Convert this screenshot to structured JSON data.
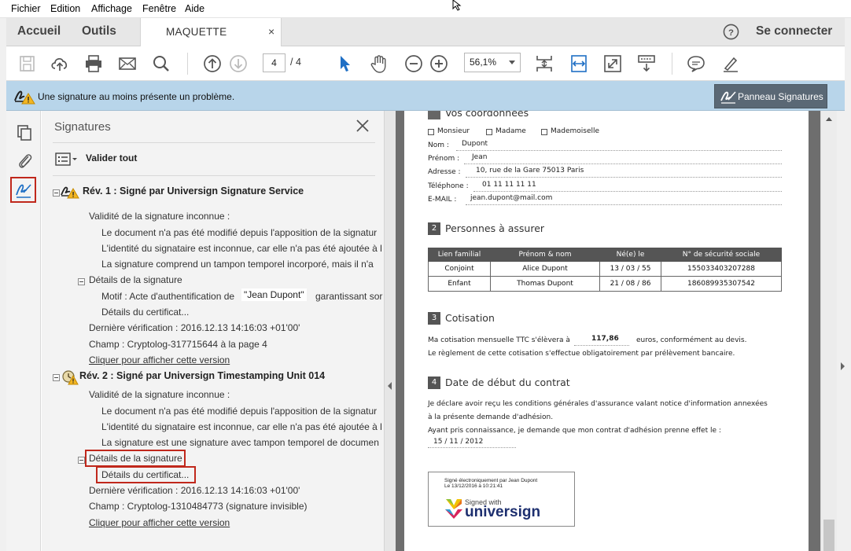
{
  "menu": {
    "items": [
      "Fichier",
      "Edition",
      "Affichage",
      "Fenêtre",
      "Aide"
    ]
  },
  "nav": {
    "home": "Accueil",
    "tools": "Outils",
    "doc_tab": "MAQUETTE",
    "close": "×",
    "signin": "Se connecter"
  },
  "toolbar": {
    "page_current": "4",
    "page_total": "/ 4",
    "zoom": "56,1%"
  },
  "banner": {
    "message": "Une signature au moins présente un problème.",
    "panel_button": "Panneau Signatures"
  },
  "signatures": {
    "title": "Signatures",
    "validate_all": "Valider tout",
    "rev1": {
      "header": "Rév. 1 : Signé par Universign Signature Service",
      "validity": "Validité de la signature inconnue :",
      "v1": "Le document n'a pas été modifié depuis l'apposition de la signatur",
      "v2": "L'identité du signataire est inconnue, car elle n'a pas été ajoutée à l",
      "v3": "La signature comprend un tampon temporel incorporé, mais il n'a",
      "details": "Détails de la signature",
      "motive_prefix": "Motif : Acte d'authentification de",
      "motive_name": "\"Jean Dupont\"",
      "motive_suffix": "garantissant sor",
      "cert": "Détails du certificat...",
      "last_check": "Dernière vérification : 2016.12.13 14:16:03 +01'00'",
      "field": "Champ : Cryptolog-317715644 à la page 4",
      "show": "Cliquer pour afficher cette version"
    },
    "rev2": {
      "header": "Rév. 2 : Signé par Universign Timestamping Unit 014",
      "validity": "Validité de la signature inconnue :",
      "v1": "Le document n'a pas été modifié depuis l'apposition de la signatur",
      "v2": "L'identité du signataire est inconnue, car elle n'a pas été ajoutée à l",
      "v3": "La signature est une signature avec tampon temporel de documen",
      "details": "Détails de la signature",
      "cert": "Détails du certificat...",
      "last_check": "Dernière vérification : 2016.12.13 14:16:03 +01'00'",
      "field": "Champ : Cryptolog-1310484773 (signature invisible)",
      "show": "Cliquer pour afficher cette version"
    }
  },
  "document": {
    "sec1_title": "Vos coordonnées",
    "civ": [
      "Monsieur",
      "Madame",
      "Mademoiselle"
    ],
    "fields": [
      {
        "label": "Nom :",
        "value": "Dupont"
      },
      {
        "label": "Prénom :",
        "value": "Jean"
      },
      {
        "label": "Adresse :",
        "value": "10, rue de la Gare 75013 Paris"
      },
      {
        "label": "Téléphone :",
        "value": "01 11 11 11 11"
      },
      {
        "label": "E-MAIL :",
        "value": "jean.dupont@mail.com"
      }
    ],
    "sec2_num": "2",
    "sec2_title": "Personnes à assurer",
    "table": {
      "headers": [
        "Lien familial",
        "Prénom & nom",
        "Né(e) le",
        "N° de sécurité sociale"
      ],
      "rows": [
        [
          "Conjoint",
          "Alice Dupont",
          "13 / 03 / 55",
          "155033403207288"
        ],
        [
          "Enfant",
          "Thomas Dupont",
          "21 / 08 / 86",
          "186089935307542"
        ]
      ]
    },
    "sec3_num": "3",
    "sec3_title": "Cotisation",
    "cot_prefix": "Ma cotisation mensuelle TTC s'élèvera à",
    "cot_value": "117,86",
    "cot_suffix": "euros, conformément au devis.",
    "cot_line2": "Le règlement de cette cotisation s'effectue obligatoirement par prélèvement bancaire.",
    "sec4_num": "4",
    "sec4_title": "Date de début du contrat",
    "date_l1": "Je déclare avoir reçu les conditions générales d'assurance valant notice d'information annexées",
    "date_l2": "à la présente demande d'adhésion.",
    "date_l3": "Ayant pris connaissance, je demande que mon contrat d'adhésion prenne effet le :",
    "date_value": "15 / 11 / 2012",
    "sig_line1": "Signé électroniquement par Jean Dupont",
    "sig_line2": "Le 13/12/2016 à 10:21:41",
    "sig_brand_small": "Signed with",
    "sig_brand": "universign"
  },
  "colors": {
    "accent_blue": "#1f6fc5",
    "highlight_red": "#c0281c",
    "banner": "#b8d5ea",
    "universign_navy": "#1d2f6f"
  }
}
